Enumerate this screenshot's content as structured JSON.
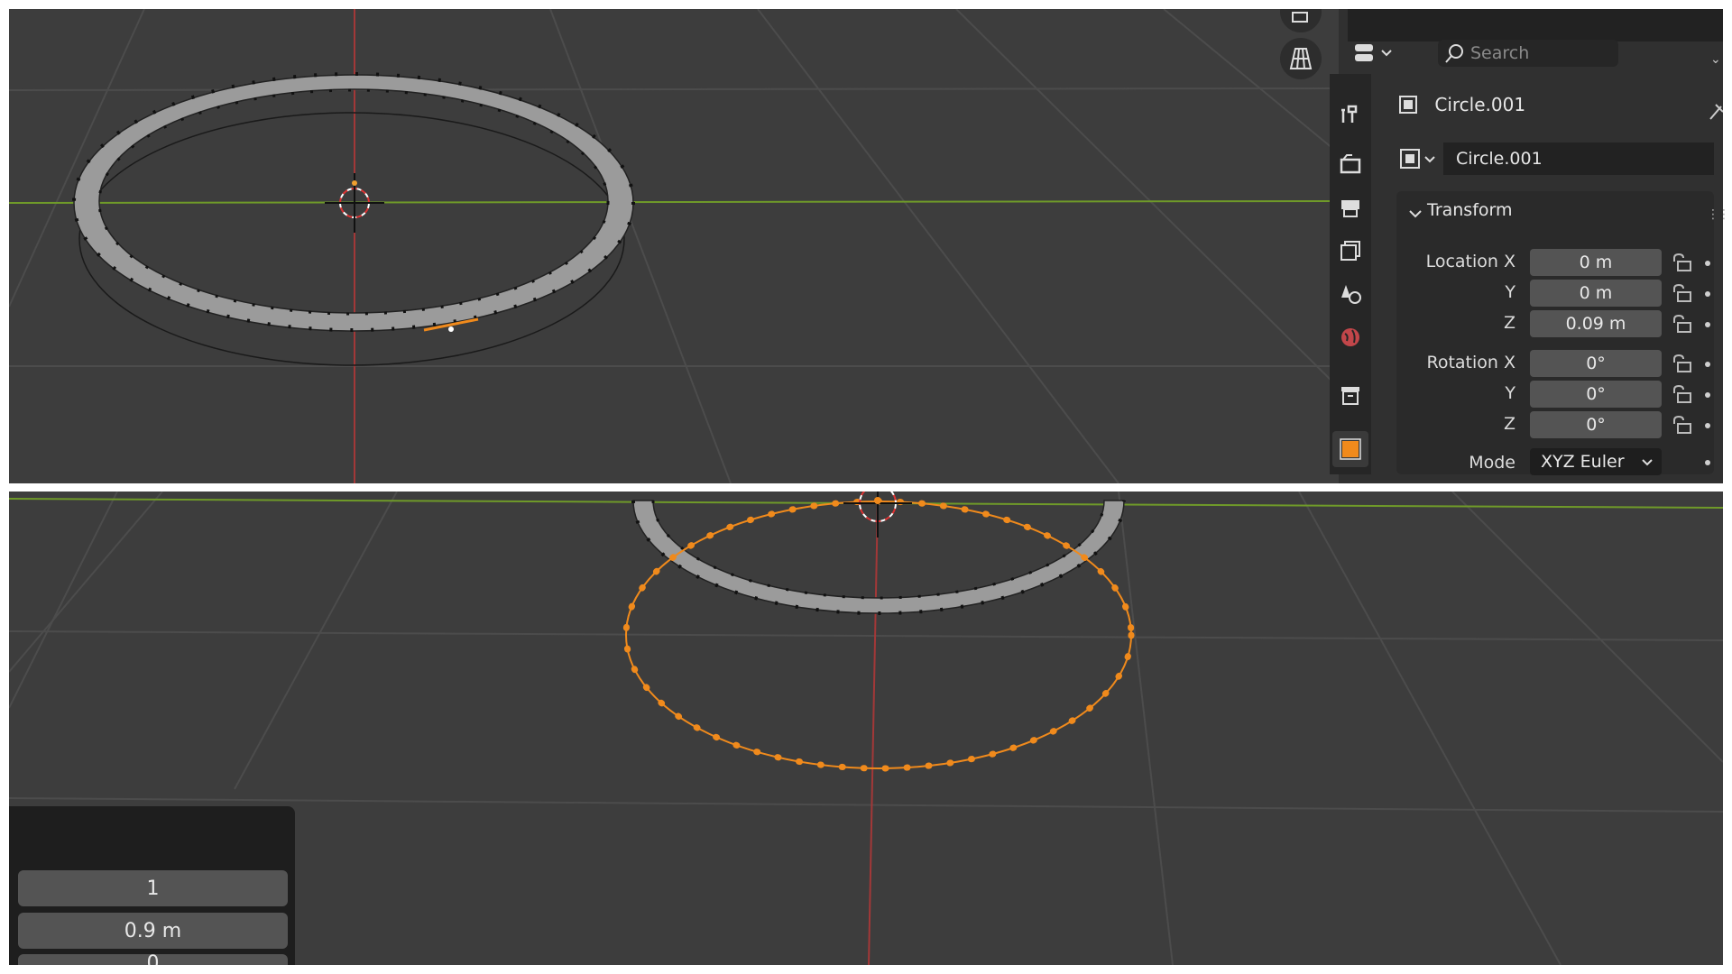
{
  "properties": {
    "search_placeholder": "Search",
    "object_name": "Circle.001",
    "object_field": "Circle.001",
    "panel_title": "Transform",
    "location": {
      "label_x": "Location X",
      "label_y": "Y",
      "label_z": "Z",
      "x": "0 m",
      "y": "0 m",
      "z": "0.09 m"
    },
    "rotation": {
      "label_x": "Rotation X",
      "label_y": "Y",
      "label_z": "Z",
      "x": "0°",
      "y": "0°",
      "z": "0°"
    },
    "mode_label": "Mode",
    "mode_value": "XYZ Euler"
  },
  "operator_panel": {
    "field1": "1",
    "field2": "0.9 m",
    "field3": "0"
  },
  "colors": {
    "viewport_bg": "#3d3d3d",
    "selected_orange": "#f08a1c",
    "x_axis": "#a33838",
    "y_axis": "#6f9a29"
  },
  "icons": [
    "camera-icon",
    "grid-icon",
    "editor-type-icon",
    "search-icon",
    "object-icon",
    "tool-icon",
    "render-icon",
    "output-icon",
    "view-layer-icon",
    "scene-icon",
    "world-icon",
    "collection-icon",
    "object-properties-icon",
    "lock-icon",
    "chevron-down-icon",
    "pin-icon"
  ]
}
